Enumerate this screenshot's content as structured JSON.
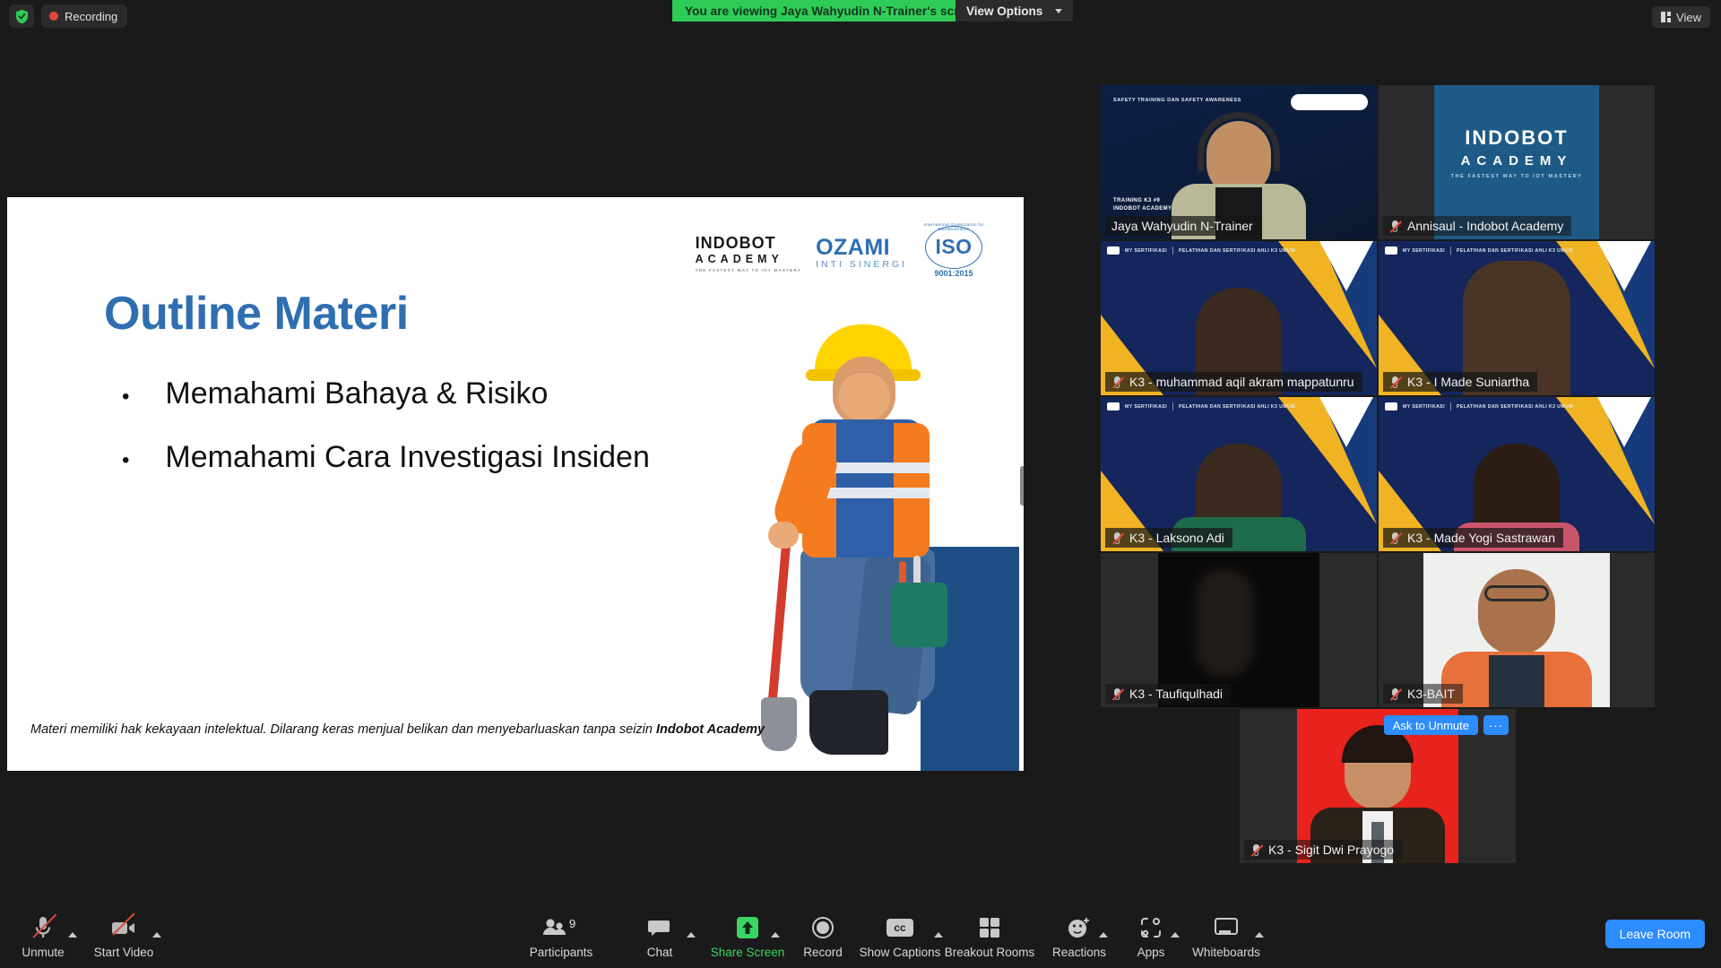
{
  "topbar": {
    "shield_icon": "shield-check-icon",
    "recording_label": "Recording",
    "share_banner": "You are viewing Jaya Wahyudin N-Trainer's screen",
    "view_options_label": "View Options",
    "view_button_label": "View"
  },
  "slide": {
    "title": "Outline Materi",
    "bullet_marker": "•",
    "bullets": [
      "Memahami Bahaya & Risiko",
      "Memahami Cara Investigasi Insiden"
    ],
    "footer_normal": "Materi memiliki hak kekayaan intelektual. Dilarang keras menjual belikan dan menyebarluaskan tanpa seizin ",
    "footer_bold": "Indobot Academy",
    "logos": {
      "indobot_name": "INDOBOT",
      "indobot_sub": "ACADEMY",
      "indobot_tag": "THE FASTEST WAY TO IOT MASTERY",
      "ozami_name": "OZAMI",
      "ozami_sub": "INTI SINERGI",
      "iso_name": "ISO",
      "iso_standard": "9001:2015",
      "iso_arc": "International Organization for Standardization"
    },
    "title_color": "#2f6fb0"
  },
  "tiles": [
    {
      "name": "Jaya Wahyudin N-Trainer",
      "muted": false,
      "active": true,
      "overlay_top": "SAFETY TRAINING DAN SAFETY AWARENESS",
      "overlay_bottom_1": "TRAINING K3 #9",
      "overlay_bottom_2": "INDOBOT ACADEMY"
    },
    {
      "name": "Annisaul - Indobot Academy",
      "muted": true,
      "active": false,
      "brand_line_1": "INDOBOT",
      "brand_line_2": "ACADEMY",
      "brand_line_3": "THE FASTEST WAY TO IOT MASTERY"
    },
    {
      "name": "K3 - muhammad aqil akram mappatunru",
      "muted": true,
      "active": false,
      "cert_badge": "MY SERTIFIKASI",
      "cert_text": "PELATIHAN DAN SERTIFIKASI AHLI K3 UMUM"
    },
    {
      "name": "K3 - I Made Suniartha",
      "muted": true,
      "active": false,
      "cert_badge": "MY SERTIFIKASI",
      "cert_text": "PELATIHAN DAN SERTIFIKASI AHLI K3 UMUM"
    },
    {
      "name": "K3 - Laksono Adi",
      "muted": true,
      "active": false,
      "cert_badge": "MY SERTIFIKASI",
      "cert_text": "PELATIHAN DAN SERTIFIKASI AHLI K3 UMUM"
    },
    {
      "name": "K3 - Made Yogi Sastrawan",
      "muted": true,
      "active": false,
      "cert_badge": "MY SERTIFIKASI",
      "cert_text": "PELATIHAN DAN SERTIFIKASI AHLI K3 UMUM"
    },
    {
      "name": "K3 - Taufiqulhadi",
      "muted": true,
      "active": false
    },
    {
      "name": "K3-BAIT",
      "muted": true,
      "active": false
    },
    {
      "name": "K3 - Sigit Dwi Prayogo",
      "muted": true,
      "active": false,
      "ask_to_unmute": "Ask to Unmute",
      "more_label": "···"
    }
  ],
  "toolbar": {
    "unmute_label": "Unmute",
    "start_video_label": "Start Video",
    "participants_label": "Participants",
    "participants_count": "9",
    "chat_label": "Chat",
    "share_screen_label": "Share Screen",
    "record_label": "Record",
    "captions_label": "Show Captions",
    "captions_icon_text": "cc",
    "breakout_label": "Breakout Rooms",
    "reactions_label": "Reactions",
    "apps_label": "Apps",
    "whiteboards_label": "Whiteboards",
    "leave_label": "Leave Room",
    "share_color": "#3ad463",
    "leave_color": "#2d8cff"
  }
}
